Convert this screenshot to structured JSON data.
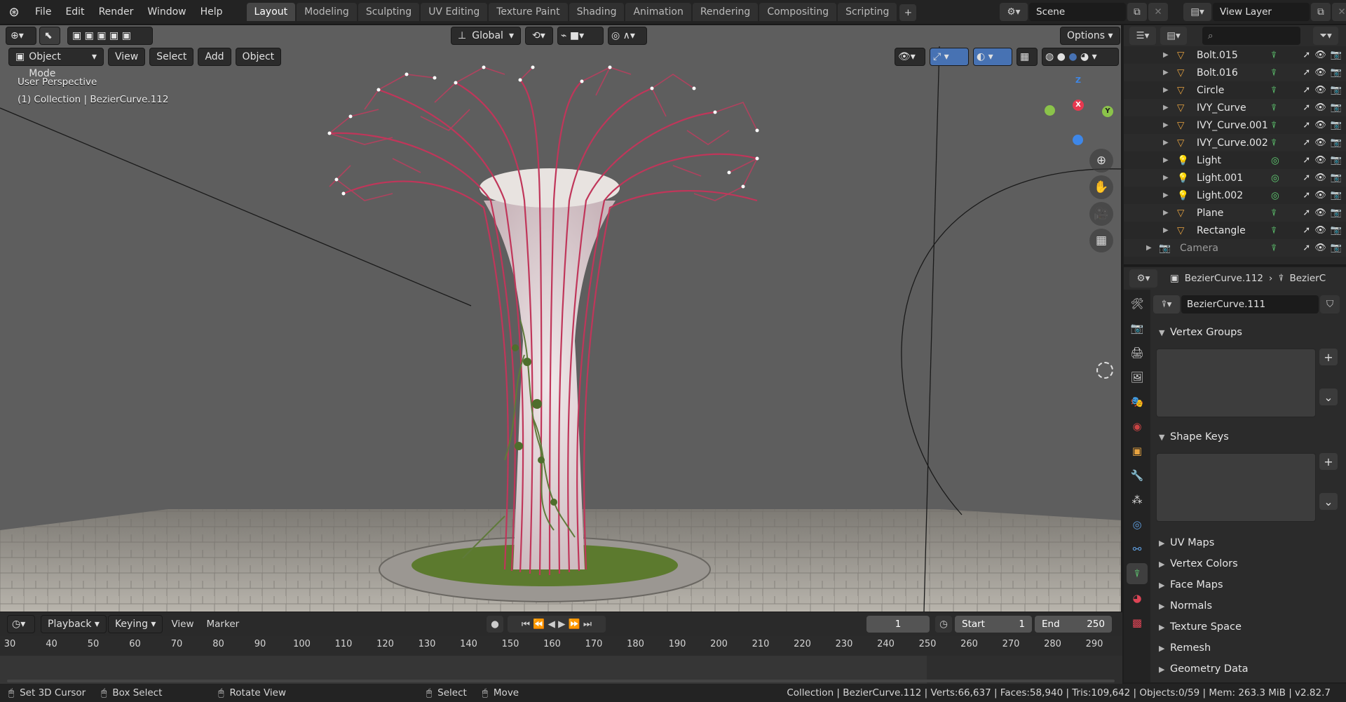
{
  "topbar": {
    "menu": [
      "File",
      "Edit",
      "Render",
      "Window",
      "Help"
    ],
    "workspaces": [
      "Layout",
      "Modeling",
      "Sculpting",
      "UV Editing",
      "Texture Paint",
      "Shading",
      "Animation",
      "Rendering",
      "Compositing",
      "Scripting"
    ],
    "active_workspace": "Layout",
    "scene": "Scene",
    "view_layer": "View Layer"
  },
  "viewport": {
    "transform_orientation": "Global",
    "options_label": "Options",
    "mode": "Object Mode",
    "menus": [
      "View",
      "Select",
      "Add",
      "Object"
    ],
    "perspective_label": "User Perspective",
    "collection_label": "(1) Collection | BezierCurve.112",
    "gizmo_axes": {
      "x": "X",
      "y": "Y",
      "z": "Z"
    }
  },
  "timeline": {
    "playback_label": "Playback",
    "keying_label": "Keying",
    "view_label": "View",
    "marker_label": "Marker",
    "current_frame": "1",
    "start_label": "Start",
    "start_value": "1",
    "end_label": "End",
    "end_value": "250",
    "ruler_ticks": [
      "30",
      "40",
      "50",
      "60",
      "70",
      "80",
      "90",
      "100",
      "110",
      "120",
      "130",
      "140",
      "150",
      "160",
      "170",
      "180",
      "190",
      "200",
      "210",
      "220",
      "230",
      "240",
      "250",
      "260",
      "270",
      "280",
      "290"
    ]
  },
  "statusbar": {
    "set_cursor": "Set 3D Cursor",
    "box_select": "Box Select",
    "rotate_view": "Rotate View",
    "select": "Select",
    "move": "Move",
    "info": "Collection | BezierCurve.112 | Verts:66,637 | Faces:58,940 | Tris:109,642 | Objects:0/59 | Mem: 263.3 MiB | v2.82.7"
  },
  "outliner": {
    "items": [
      {
        "name": "Bolt.015",
        "type": "curve"
      },
      {
        "name": "Bolt.016",
        "type": "curve"
      },
      {
        "name": "Circle",
        "type": "curve"
      },
      {
        "name": "IVY_Curve",
        "type": "curve"
      },
      {
        "name": "IVY_Curve.001",
        "type": "curve"
      },
      {
        "name": "IVY_Curve.002",
        "type": "curve"
      },
      {
        "name": "Light",
        "type": "light"
      },
      {
        "name": "Light.001",
        "type": "light"
      },
      {
        "name": "Light.002",
        "type": "light"
      },
      {
        "name": "Plane",
        "type": "curve"
      },
      {
        "name": "Rectangle",
        "type": "curve"
      },
      {
        "name": "Camera",
        "type": "camera"
      }
    ]
  },
  "properties": {
    "breadcrumb_object": "BezierCurve.112",
    "breadcrumb_data": "BezierC",
    "data_name": "BezierCurve.111",
    "panels": {
      "vertex_groups": "Vertex Groups",
      "shape_keys": "Shape Keys",
      "uv_maps": "UV Maps",
      "vertex_colors": "Vertex Colors",
      "face_maps": "Face Maps",
      "normals": "Normals",
      "texture_space": "Texture Space",
      "remesh": "Remesh",
      "geometry_data": "Geometry Data"
    }
  },
  "colors": {
    "accent_blue": "#4772b3",
    "curve_pink": "#c0365a",
    "axis_x": "#e8384f",
    "axis_y": "#8bc34a",
    "axis_z": "#3e87e8"
  }
}
